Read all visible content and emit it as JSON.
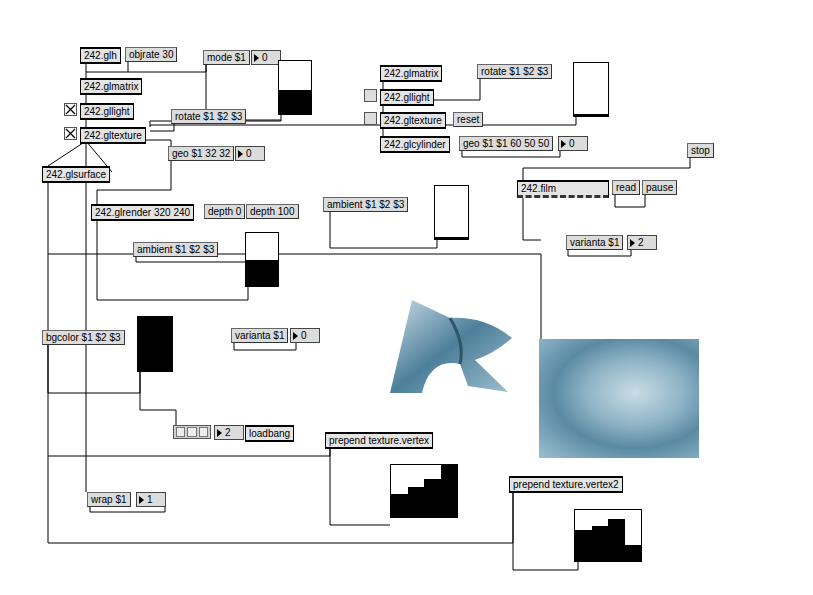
{
  "patcher": {
    "objects": [
      {
        "kind": "object",
        "text": "242.glh"
      },
      {
        "kind": "message",
        "text": "objrate 30"
      },
      {
        "kind": "message",
        "text": "mode $1"
      },
      {
        "kind": "number",
        "text": "0"
      },
      {
        "kind": "slider",
        "level": 0.45
      },
      {
        "kind": "object",
        "text": "242.glmatrix"
      },
      {
        "kind": "toggle",
        "checked": true
      },
      {
        "kind": "object",
        "text": "242.gllight"
      },
      {
        "kind": "toggle",
        "checked": true
      },
      {
        "kind": "object",
        "text": "242.gltexture"
      },
      {
        "kind": "message",
        "text": "rotate $1 $2 $3"
      },
      {
        "kind": "message",
        "text": "geo $1 32 32"
      },
      {
        "kind": "number",
        "text": "0"
      },
      {
        "kind": "object",
        "text": "242.glsurface"
      },
      {
        "kind": "object",
        "text": "242.glrender 320 240"
      },
      {
        "kind": "message",
        "text": "depth 0"
      },
      {
        "kind": "message",
        "text": "depth 100"
      },
      {
        "kind": "message",
        "text": "ambient $1 $2 $3"
      },
      {
        "kind": "slider",
        "level": 0.5
      },
      {
        "kind": "message",
        "text": "bgcolor $1 $2 $3"
      },
      {
        "kind": "slider",
        "level": 1
      },
      {
        "kind": "message",
        "text": "varianta $1"
      },
      {
        "kind": "number",
        "text": "0"
      },
      {
        "kind": "grid"
      },
      {
        "kind": "number",
        "text": "2"
      },
      {
        "kind": "object",
        "text": "loadbang"
      },
      {
        "kind": "object",
        "text": "prepend texture.vertex"
      },
      {
        "kind": "multislider",
        "values": [
          0.45,
          0.57,
          0.74,
          1
        ]
      },
      {
        "kind": "message",
        "text": "wrap $1"
      },
      {
        "kind": "number",
        "text": "1"
      },
      {
        "kind": "object",
        "text": "prepend texture.vertex2"
      },
      {
        "kind": "multislider",
        "values": [
          0.6,
          0.68,
          0.83,
          0.32
        ]
      },
      {
        "kind": "object",
        "text": "242.glmatrix"
      },
      {
        "kind": "message",
        "text": "rotate $1 $2 $3"
      },
      {
        "kind": "slider",
        "level": 0.04
      },
      {
        "kind": "toggle",
        "checked": false
      },
      {
        "kind": "object",
        "text": "242.gllight"
      },
      {
        "kind": "toggle",
        "checked": false
      },
      {
        "kind": "object",
        "text": "242.gltexture"
      },
      {
        "kind": "message",
        "text": "reset"
      },
      {
        "kind": "object",
        "text": "242.glcylinder"
      },
      {
        "kind": "message",
        "text": "geo $1 $1 60 50 50"
      },
      {
        "kind": "number",
        "text": "0"
      },
      {
        "kind": "message",
        "text": "stop"
      },
      {
        "kind": "film",
        "text": "242.film"
      },
      {
        "kind": "message",
        "text": "read"
      },
      {
        "kind": "message",
        "text": "pause"
      },
      {
        "kind": "message",
        "text": "ambient $1 $2 $3"
      },
      {
        "kind": "slider",
        "level": 0.04
      },
      {
        "kind": "message",
        "text": "varianta $1"
      },
      {
        "kind": "number",
        "text": "2"
      },
      {
        "kind": "surface-picture"
      },
      {
        "kind": "film-picture"
      }
    ]
  }
}
